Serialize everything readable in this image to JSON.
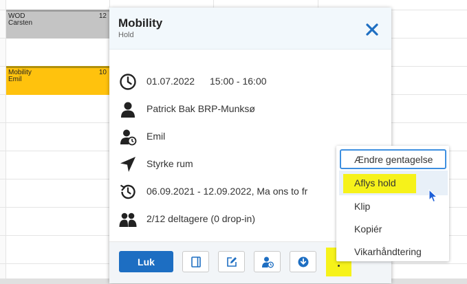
{
  "calendar": {
    "events": [
      {
        "title": "WOD",
        "person": "Carsten",
        "count": "12",
        "color": "#c4c4c4"
      },
      {
        "title": "Mobility",
        "person": "Emil",
        "count": "10",
        "color": "#ffc20d"
      }
    ]
  },
  "popup": {
    "title": "Mobility",
    "subtitle": "Hold",
    "close_icon": "close-icon",
    "details": {
      "date": "01.07.2022",
      "time": "15:00 - 16:00",
      "instructor": "Patrick Bak BRP-Munksø",
      "substitute": "Emil",
      "location": "Styrke rum",
      "recurrence": "06.09.2021 - 12.09.2022, Ma ons to fr",
      "participants": "2/12 deltagere (0 drop-in)"
    },
    "footer": {
      "close_label": "Luk",
      "icons": [
        "notebook-icon",
        "edit-icon",
        "user-clock-icon",
        "download-icon",
        "more-icon"
      ]
    }
  },
  "dropdown": {
    "items": [
      "Ændre gentagelse",
      "Aflys hold",
      "Klip",
      "Kopiér",
      "Vikarhåndtering"
    ]
  },
  "colors": {
    "accent": "#1d6ec2",
    "highlight": "#f6f21a",
    "header_bg": "#f2f8fc"
  }
}
